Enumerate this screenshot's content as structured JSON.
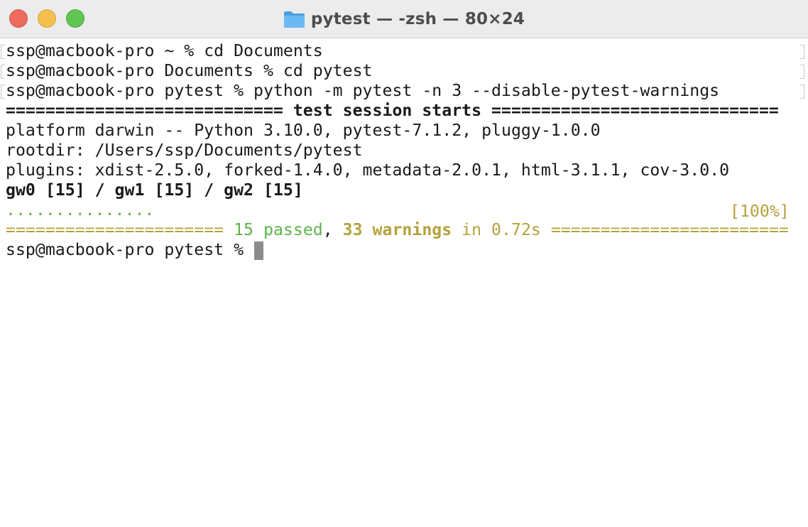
{
  "window": {
    "title": "pytest — -zsh — 80×24",
    "title_icon": "folder-icon",
    "traffic_lights": {
      "close": "#ed6a5e",
      "minimize": "#f5bf4f",
      "maximize": "#61c554"
    }
  },
  "terminal": {
    "history": [
      "ssp@macbook-pro ~ % cd Documents",
      "ssp@macbook-pro Documents % cd pytest",
      "ssp@macbook-pro pytest % python -m pytest -n 3 --disable-pytest-warnings"
    ],
    "session_header": "============================ test session starts =============================",
    "platform": "platform darwin -- Python 3.10.0, pytest-7.1.2, pluggy-1.0.0",
    "rootdir": "rootdir: /Users/ssp/Documents/pytest",
    "plugins": "plugins: xdist-2.5.0, forked-1.4.0, metadata-2.0.1, html-3.1.1, cov-3.0.0",
    "workers": "gw0 [15] / gw1 [15] / gw2 [15]",
    "progress_dots": "...............",
    "progress_percent": "[100%]",
    "summary": {
      "left_rule": "====================== ",
      "passed": "15 passed",
      "comma": ", ",
      "warnings": "33 warnings",
      "duration": " in 0.72s ",
      "right_rule": "========================"
    },
    "prompt": "ssp@macbook-pro pytest % "
  },
  "colors": {
    "passed_green": "#5cb54a",
    "warning_yellow": "#b5a23c",
    "text": "#1a1a1a"
  }
}
